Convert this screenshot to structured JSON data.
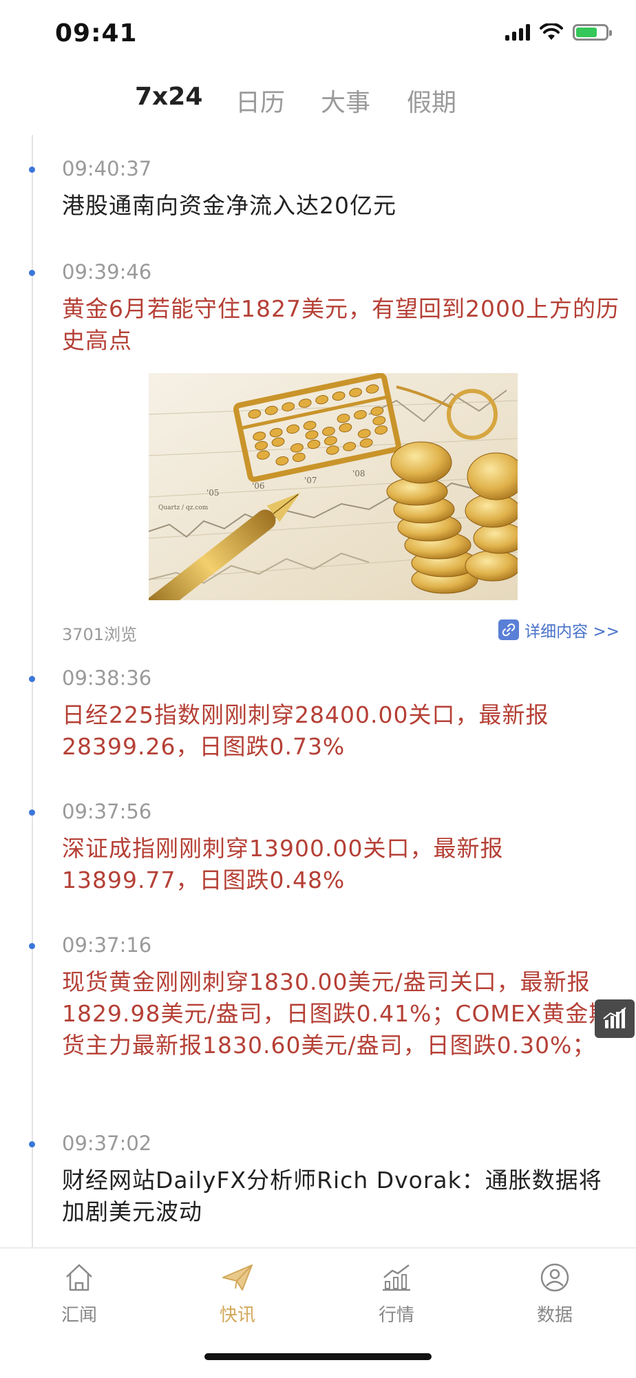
{
  "status_bar": {
    "time": "09:41"
  },
  "tabs": [
    {
      "label": "7x24",
      "active": true
    },
    {
      "label": "日历",
      "active": false
    },
    {
      "label": "大事",
      "active": false
    },
    {
      "label": "假期",
      "active": false
    }
  ],
  "feed": [
    {
      "time": "09:40:37",
      "headline": "港股通南向资金净流入达20亿元",
      "color": "#222222"
    },
    {
      "time": "09:39:46",
      "headline": "黄金6月若能守住1827美元，有望回到2000上方的历史高点",
      "color": "#b54036",
      "views": "3701浏览",
      "detail_label": "详细内容 >>",
      "image_labels": [
        "'05",
        "'06",
        "'07",
        "'08",
        "Quartz / qz.com"
      ]
    },
    {
      "time": "09:38:36",
      "headline": "日经225指数刚刚刺穿28400.00关口，最新报28399.26，日图跌0.73%",
      "color": "#b54036"
    },
    {
      "time": "09:37:56",
      "headline": "深证成指刚刚刺穿13900.00关口，最新报13899.77，日图跌0.48%",
      "color": "#b54036"
    },
    {
      "time": "09:37:16",
      "headline": "现货黄金刚刚刺穿1830.00美元/盎司关口，最新报1829.98美元/盎司，日图跌0.41%；COMEX黄金期货主力最新报1830.60美元/盎司，日图跌0.30%；",
      "color": "#b54036"
    },
    {
      "time": "09:37:02",
      "headline": "财经网站DailyFX分析师Rich Dvorak：通胀数据将加剧美元波动",
      "color": "#222222"
    }
  ],
  "bottom_nav": [
    {
      "label": "汇闻",
      "icon": "home-icon",
      "active": false
    },
    {
      "label": "快讯",
      "icon": "paper-plane-icon",
      "active": true
    },
    {
      "label": "行情",
      "icon": "chart-trend-icon",
      "active": false
    },
    {
      "label": "数据",
      "icon": "user-circle-icon",
      "active": false
    }
  ],
  "colors": {
    "accent_gold": "#d2a85a",
    "headline_red": "#b54036",
    "link_blue": "#4a73c9",
    "dot_blue": "#3a76d8"
  }
}
